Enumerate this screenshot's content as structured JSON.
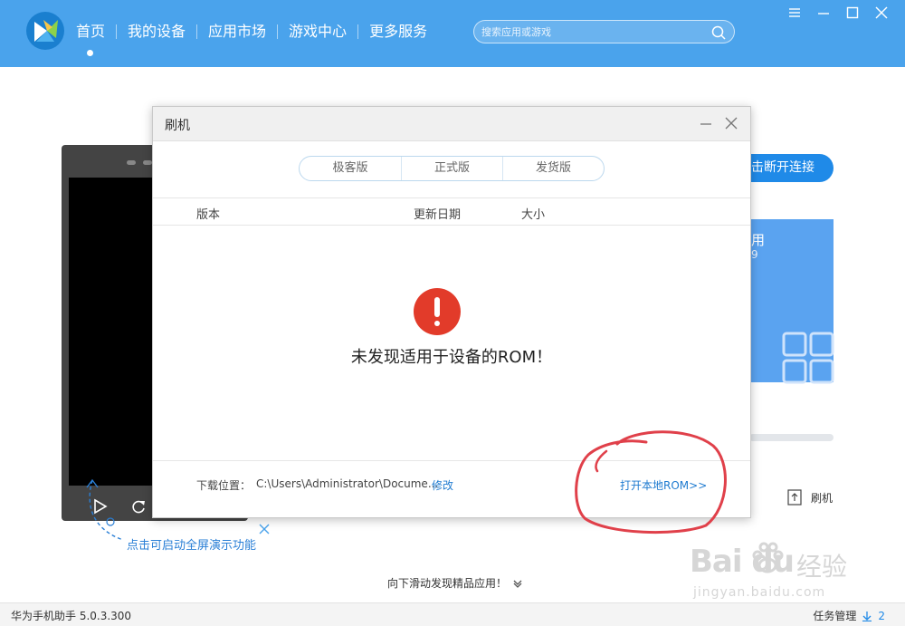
{
  "app": {
    "nav": [
      "首页",
      "我的设备",
      "应用市场",
      "游戏中心",
      "更多服务"
    ],
    "active_nav_index": 0,
    "search_placeholder": "搜索应用或游戏",
    "version": "华为手机助手 5.0.3.300"
  },
  "background": {
    "disconnect_label": "击断开连接",
    "card_text": "用",
    "card_sub": "9",
    "flash_label": "刷机",
    "demo_hint": "点击可启动全屏演示功能",
    "scroll_hint": "向下滑动发现精品应用！"
  },
  "dialog": {
    "title": "刷机",
    "tabs": [
      "极客版",
      "正式版",
      "发货版"
    ],
    "columns": {
      "version": "版本",
      "date": "更新日期",
      "size": "大小"
    },
    "error_message": "未发现适用于设备的ROM！",
    "download_label": "下载位置：",
    "download_path": "C:\\Users\\Administrator\\Docume...",
    "modify_label": "修改",
    "open_local": "打开本地ROM>>"
  },
  "footer": {
    "tasks_label": "任务管理",
    "tasks_count": "2"
  },
  "watermark": {
    "main": "Bai du",
    "cn": "经验",
    "url": "jingyan.baidu.com"
  },
  "colors": {
    "header": "#4aa3ec",
    "accent": "#1f8ae8",
    "error": "#e23b2a",
    "annotation": "#e0404a"
  }
}
